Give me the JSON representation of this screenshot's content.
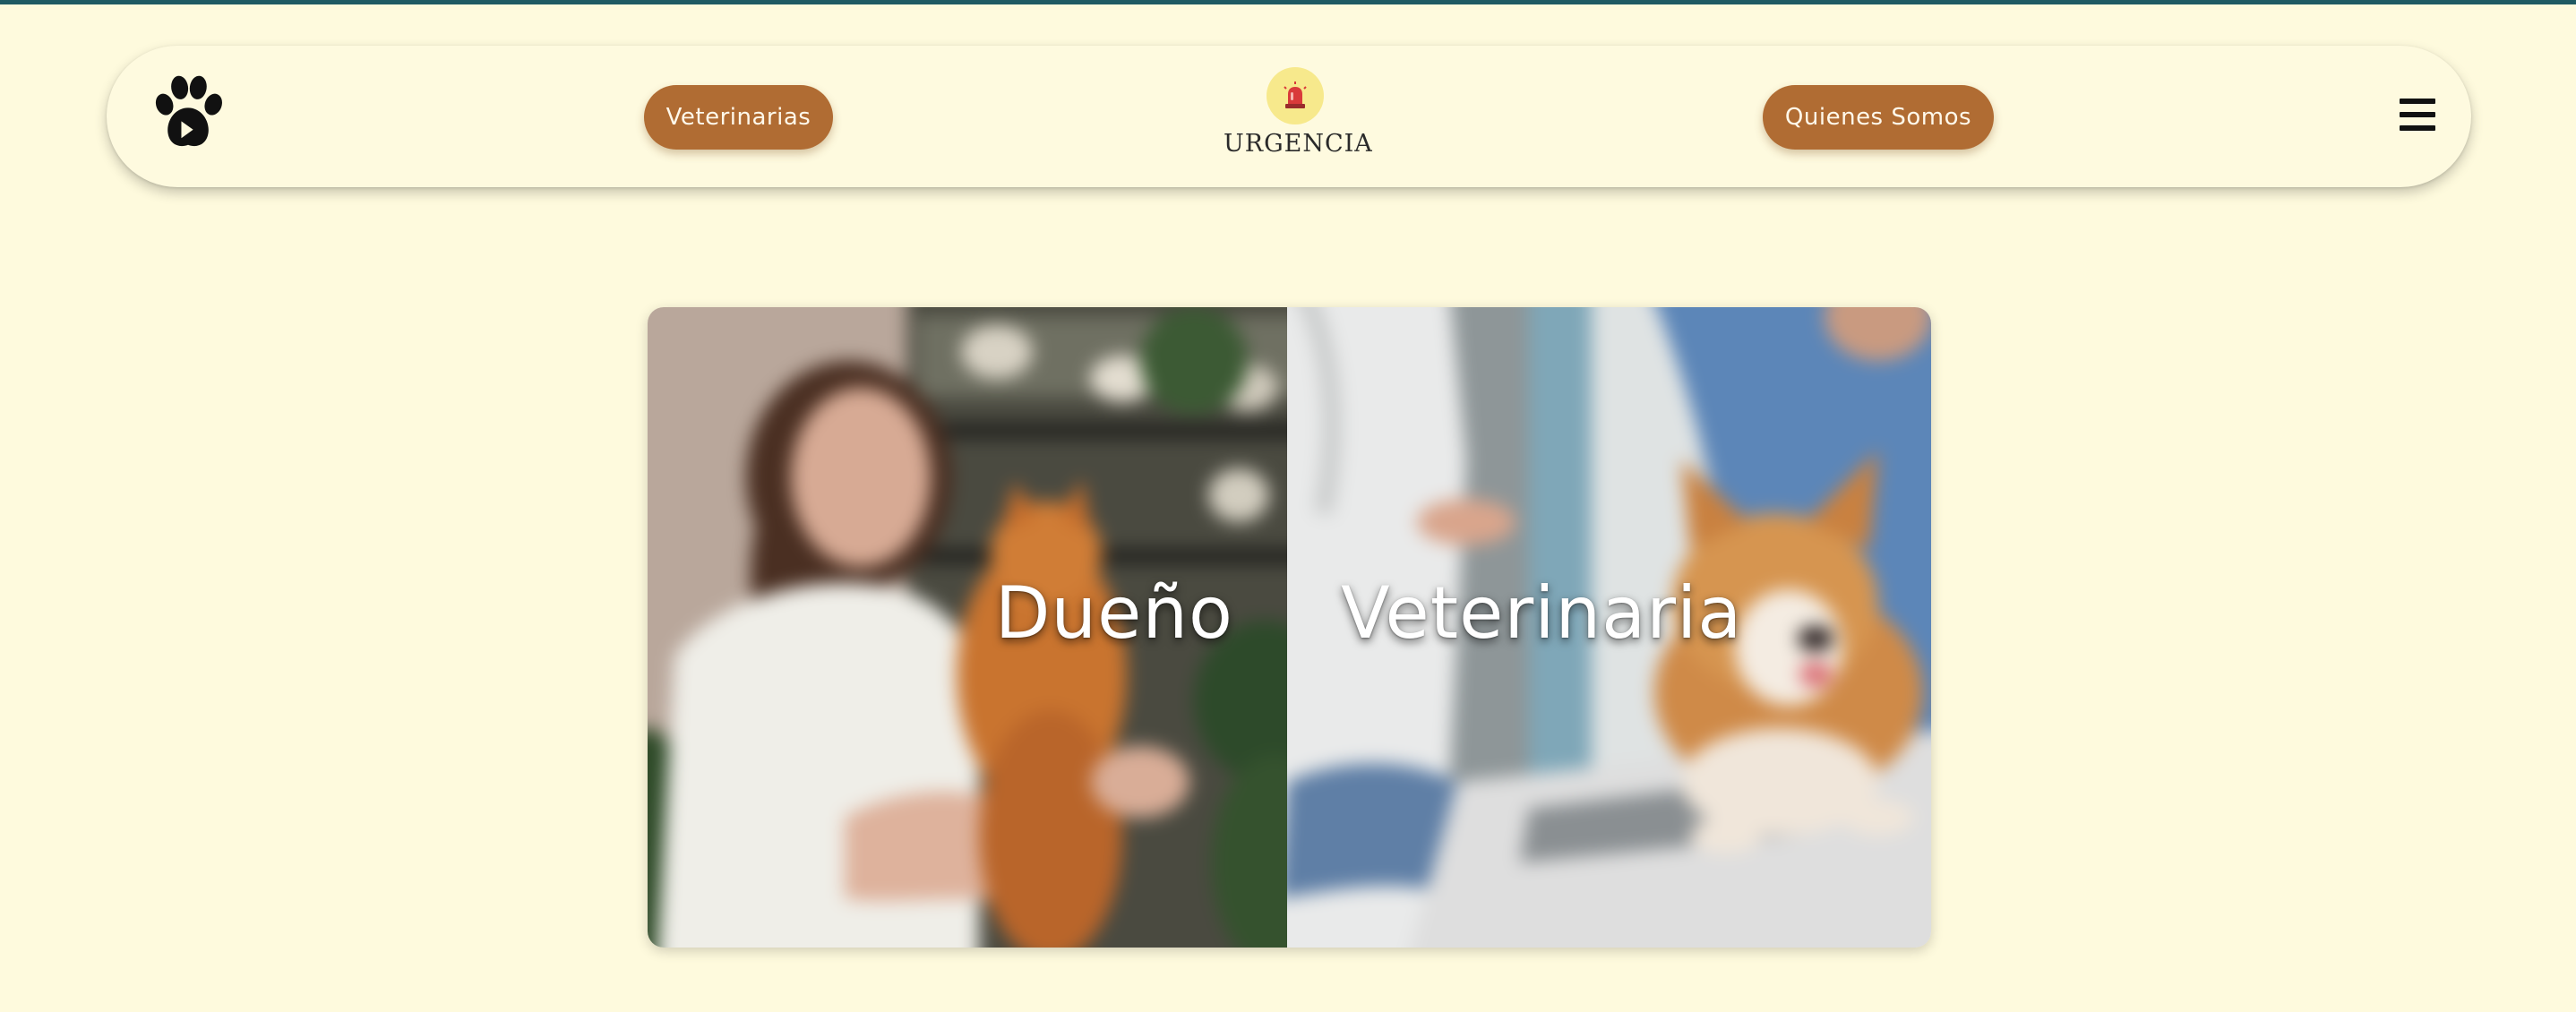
{
  "header": {
    "logo_icon": "paw-icon",
    "buttons": {
      "veterinarias": "Veterinarias",
      "quienes_somos": "Quienes Somos"
    },
    "urgencia": {
      "icon": "siren-icon",
      "label": "URGENCIA"
    },
    "menu_icon": "hamburger-menu-icon"
  },
  "main": {
    "roles": [
      {
        "label": "Dueño",
        "image": "woman-holding-orange-cat"
      },
      {
        "label": "Veterinaria",
        "image": "veterinarian-examining-corgi"
      }
    ]
  },
  "colors": {
    "background": "#fefadd",
    "top_bar": "#1f5a63",
    "pill": "#b06c33",
    "siren_circle": "#f7e98c"
  }
}
